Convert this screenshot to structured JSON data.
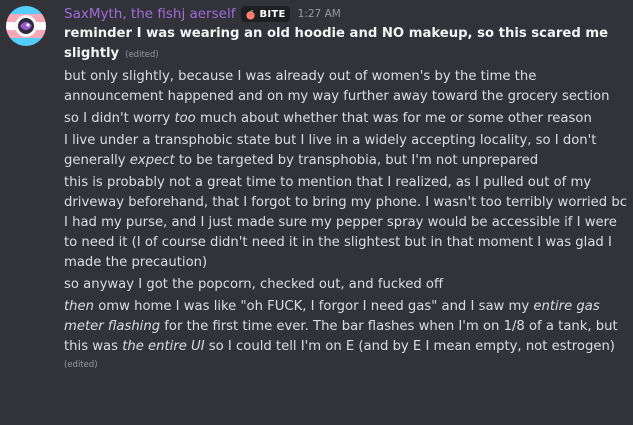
{
  "header": {
    "username": "SaxMyth, the fishj aerself",
    "tag": "BITE",
    "tag_icon": "peach-icon",
    "timestamp": "1:27 AM"
  },
  "colors": {
    "background": "#313338",
    "username": "#a26bdb",
    "text": "#dbdee1",
    "muted": "#949ba4"
  },
  "messages": [
    {
      "parts": [
        "reminder I was wearing an old hoodie and NO makeup, so this scared me slightly"
      ],
      "edited": "(edited)"
    },
    {
      "parts": [
        "but only slightly, because I was already out of women's by the time the announcement happened and on my way further away toward the grocery section"
      ]
    },
    {
      "parts": [
        "so I didn't worry ",
        "too",
        " much about whether that was for me or some other reason"
      ]
    },
    {
      "parts": [
        "I live under a transphobic state but I live in a widely accepting locality, so I don't generally ",
        "expect",
        " to be targeted by transphobia, but I'm not unprepared"
      ]
    },
    {
      "parts": [
        "this is probably not a great time to mention that I realized, as I pulled out of my driveway beforehand, that I forgot to bring my phone. I wasn't too terribly worried bc I had my purse, and I just made sure my pepper spray would be accessible if I were to need it (I of course didn't need it in the slightest but in that moment I was glad I made the precaution)"
      ]
    },
    {
      "parts": [
        "so anyway I got the popcorn, checked out, and fucked off"
      ]
    },
    {
      "parts": [
        "then",
        " omw home I was like \"oh FUCK, I forgor I need gas\" and I saw my ",
        "entire gas meter flashing",
        " for the first time ever. The bar flashes when I'm on 1/8 of a tank, but this was ",
        "the entire UI",
        " so I could tell I'm on E (and by E I mean empty, not estrogen)"
      ],
      "edited": "(edited)"
    }
  ]
}
